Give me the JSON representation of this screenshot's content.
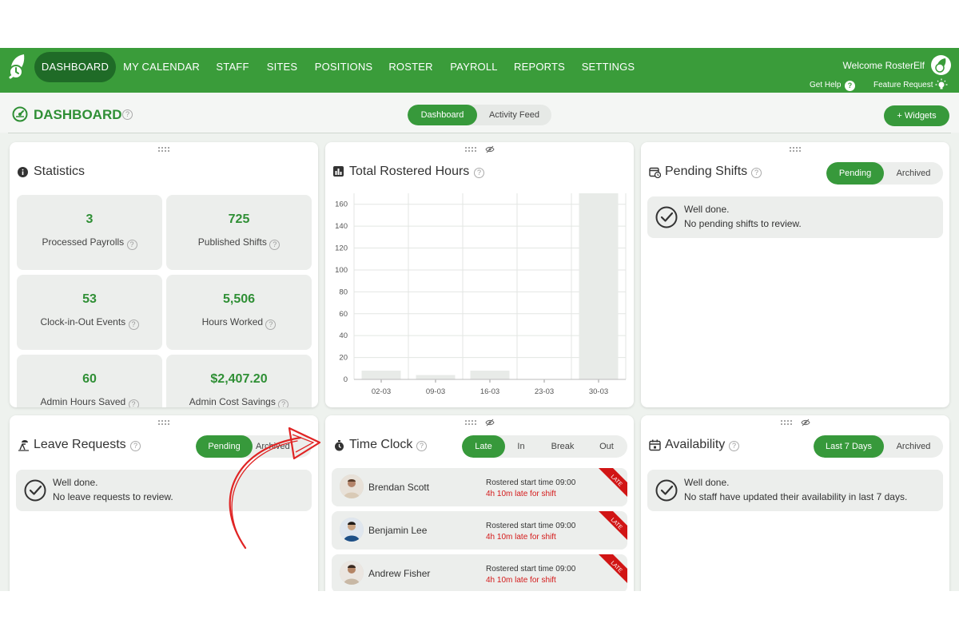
{
  "nav": {
    "items": [
      "DASHBOARD",
      "MY CALENDAR",
      "STAFF",
      "SITES",
      "POSITIONS",
      "ROSTER",
      "PAYROLL",
      "REPORTS",
      "SETTINGS"
    ],
    "active_index": 0,
    "welcome": "Welcome RosterElf",
    "get_help": "Get Help",
    "feature_request": "Feature Request"
  },
  "header": {
    "title": "DASHBOARD",
    "tabs": [
      "Dashboard",
      "Activity Feed"
    ],
    "active_tab": 0,
    "add_widgets": "+ Widgets"
  },
  "statistics": {
    "title": "Statistics",
    "cards": [
      {
        "value": "3",
        "label": "Processed Payrolls"
      },
      {
        "value": "725",
        "label": "Published Shifts"
      },
      {
        "value": "53",
        "label": "Clock-in-Out Events"
      },
      {
        "value": "5,506",
        "label": "Hours Worked"
      },
      {
        "value": "60",
        "label": "Admin Hours Saved"
      },
      {
        "value": "$2,407.20",
        "label": "Admin Cost Savings"
      }
    ]
  },
  "rostered_hours": {
    "title": "Total Rostered Hours",
    "chart_data": {
      "type": "bar",
      "categories": [
        "02-03",
        "09-03",
        "16-03",
        "23-03",
        "30-03"
      ],
      "values": [
        8,
        4,
        8,
        0,
        178
      ],
      "ylim": [
        0,
        170
      ],
      "yticks": [
        0,
        20,
        40,
        60,
        80,
        100,
        120,
        140,
        160
      ],
      "grid": true
    }
  },
  "pending_shifts": {
    "title": "Pending Shifts",
    "tabs": [
      "Pending",
      "Archived"
    ],
    "line1": "Well done.",
    "line2": "No pending shifts to review."
  },
  "leave_requests": {
    "title": "Leave Requests",
    "tabs": [
      "Pending",
      "Archived"
    ],
    "line1": "Well done.",
    "line2": "No leave requests to review."
  },
  "time_clock": {
    "title": "Time Clock",
    "tabs": [
      "Late",
      "In",
      "Break",
      "Out"
    ],
    "ribbon": "LATE",
    "rows": [
      {
        "name": "Brendan Scott",
        "start": "Rostered start time 09:00",
        "late": "4h 10m late for shift"
      },
      {
        "name": "Benjamin Lee",
        "start": "Rostered start time 09:00",
        "late": "4h 10m late for shift"
      },
      {
        "name": "Andrew Fisher",
        "start": "Rostered start time 09:00",
        "late": "4h 10m late for shift"
      }
    ]
  },
  "availability": {
    "title": "Availability",
    "tabs": [
      "Last 7 Days",
      "Archived"
    ],
    "line1": "Well done.",
    "line2": "No staff have updated their availability in last 7 days."
  },
  "colors": {
    "brand_green": "#3a9c3a",
    "active_nav": "#1f6b27",
    "accent_text": "#2f8f35",
    "late_red": "#d41a1a",
    "arrow_red": "#e02424"
  }
}
